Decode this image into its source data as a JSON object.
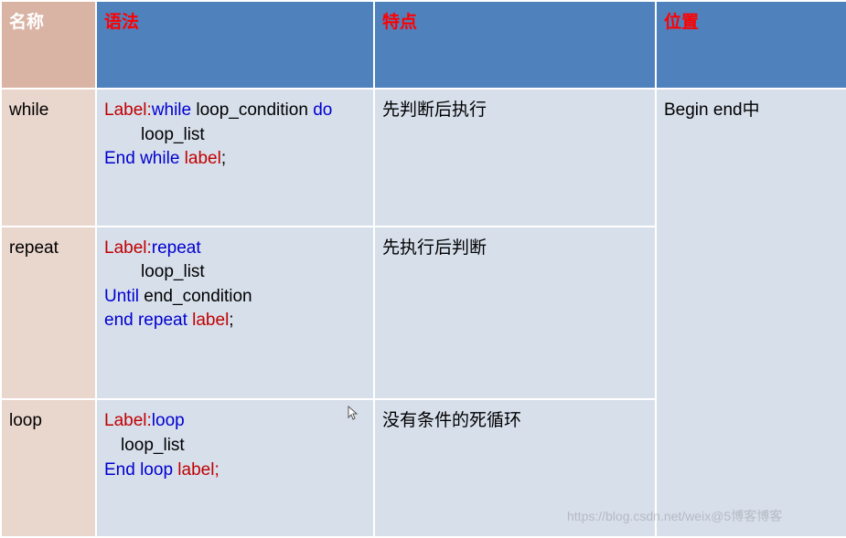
{
  "headers": {
    "name": "名称",
    "syntax": "语法",
    "feature": "特点",
    "location": "位置"
  },
  "rows": [
    {
      "name": "while",
      "syntax": {
        "line1_label": "Label:",
        "line1_kw": "while ",
        "line1_cond": "loop_condition ",
        "line1_do": "do",
        "line2": "loop_list",
        "line3_kw": "End while ",
        "line3_label": "label",
        "line3_semi": ";"
      },
      "feature": "先判断后执行",
      "location": "Begin end中"
    },
    {
      "name": "repeat",
      "syntax": {
        "line1_label": "Label:",
        "line1_kw": "repeat",
        "line2": "loop_list",
        "line3_kw": "Until ",
        "line3_cond": "end_condition",
        "line4_kw": "end repeat ",
        "line4_label": "label",
        "line4_semi": ";"
      },
      "feature": "先执行后判断"
    },
    {
      "name": "loop",
      "syntax": {
        "line1_label": "Label:",
        "line1_kw": "loop",
        "line2": "loop_list",
        "line3_kw": "End loop ",
        "line3_label": "label;"
      },
      "feature": "没有条件的死循环"
    }
  ],
  "watermark": "https://blog.csdn.net/weix@5博客博客"
}
